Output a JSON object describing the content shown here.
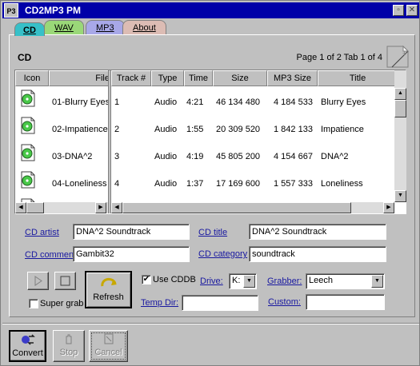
{
  "window": {
    "app_icon": "P3",
    "title": "CD2MP3 PM"
  },
  "tabs": [
    {
      "label": "CD",
      "color": "#37c0c8"
    },
    {
      "label": "WAV",
      "color": "#9ad878"
    },
    {
      "label": "MP3",
      "color": "#a8a8e8"
    },
    {
      "label": "About",
      "color": "#dcbcb4"
    }
  ],
  "panel": {
    "title": "CD",
    "page_info": "Page 1 of 2  Tab 1 of 4"
  },
  "table": {
    "columns": {
      "icon": "Icon",
      "file": "File",
      "track": "Track #",
      "type": "Type",
      "time": "Time",
      "size": "Size",
      "mp3size": "MP3 Size",
      "title": "Title"
    },
    "rows": [
      {
        "file": "01-Blurry Eyes",
        "track": "1",
        "type": "Audio",
        "time": "4:21",
        "size": "46 134 480",
        "mp3size": "4 184 533",
        "title": "Blurry Eyes"
      },
      {
        "file": "02-Impatience",
        "track": "2",
        "type": "Audio",
        "time": "1:55",
        "size": "20 309 520",
        "mp3size": "1 842 133",
        "title": "Impatience"
      },
      {
        "file": "03-DNA^2",
        "track": "3",
        "type": "Audio",
        "time": "4:19",
        "size": "45 805 200",
        "mp3size": "4 154 667",
        "title": "DNA^2"
      },
      {
        "file": "04-Loneliness",
        "track": "4",
        "type": "Audio",
        "time": "1:37",
        "size": "17 169 600",
        "mp3size": "1 557 333",
        "title": "Loneliness"
      }
    ]
  },
  "form": {
    "cd_artist_label": "CD artist",
    "cd_artist": "DNA^2 Soundtrack",
    "cd_title_label": "CD title",
    "cd_title": "DNA^2 Soundtrack",
    "cd_comment_label": "CD comment",
    "cd_comment": "Gambit32",
    "cd_category_label": "CD category",
    "cd_category": "soundtrack",
    "use_cddb": "Use CDDB",
    "drive_label": "Drive:",
    "drive": "K:",
    "grabber_label": "Grabber:",
    "grabber": "Leech",
    "temp_dir_label": "Temp Dir:",
    "temp_dir": "",
    "custom_label": "Custom:",
    "custom": "",
    "super_grab": "Super grab",
    "refresh": "Refresh"
  },
  "toolbar": {
    "convert": "Convert",
    "stop": "Stop",
    "cancel": "Cancel"
  }
}
